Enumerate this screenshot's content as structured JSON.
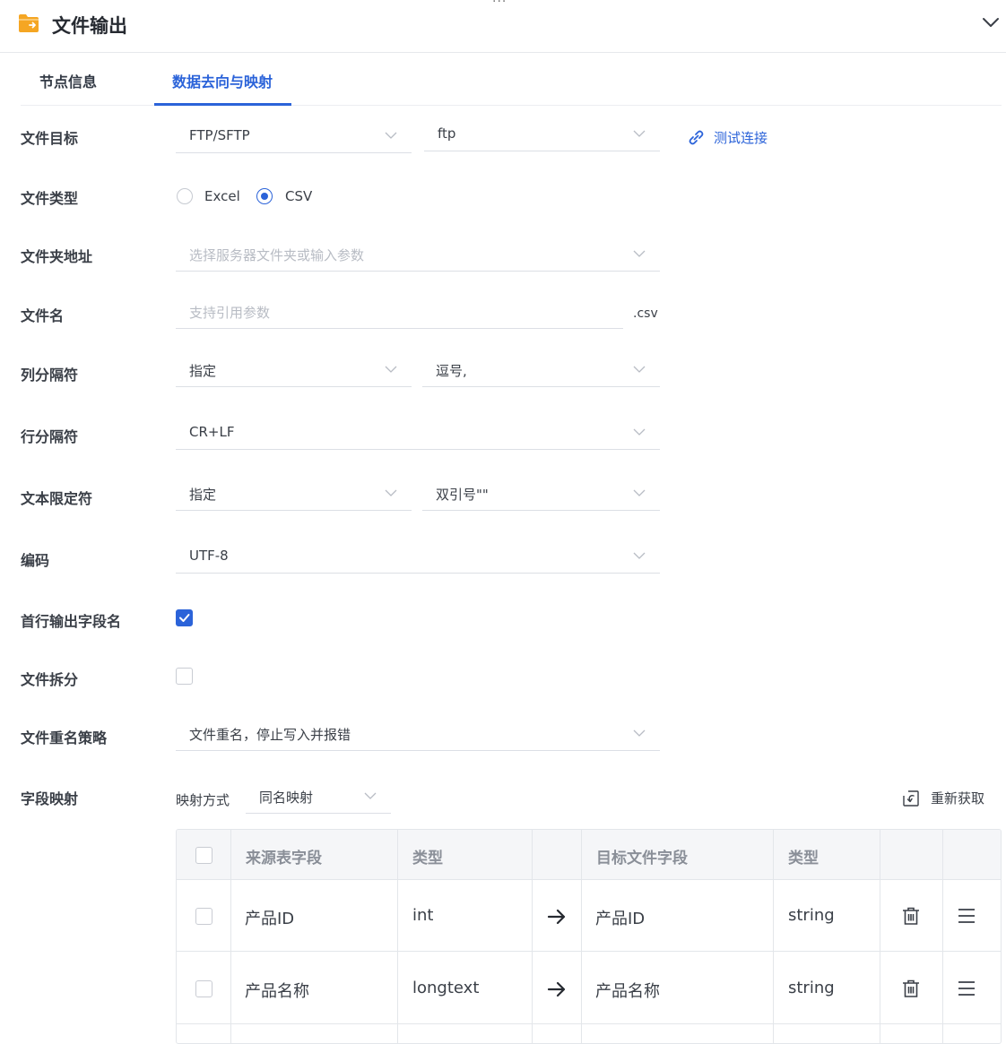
{
  "header": {
    "title": "文件输出",
    "top_fragment": "...",
    "icon": "folder-export-icon",
    "collapse_icon": "chevron-down-icon"
  },
  "tabs": [
    {
      "label": "节点信息",
      "active": false
    },
    {
      "label": "数据去向与映射",
      "active": true
    }
  ],
  "form": {
    "file_target": {
      "label": "文件目标",
      "type_value": "FTP/SFTP",
      "conn_value": "ftp",
      "test_label": "测试连接"
    },
    "file_type": {
      "label": "文件类型",
      "options": [
        "Excel",
        "CSV"
      ],
      "selected": "CSV"
    },
    "folder": {
      "label": "文件夹地址",
      "placeholder": "选择服务器文件夹或输入参数"
    },
    "file_name": {
      "label": "文件名",
      "placeholder": "支持引用参数",
      "suffix": ".csv"
    },
    "col_sep": {
      "label": "列分隔符",
      "mode": "指定",
      "value": "逗号,"
    },
    "row_sep": {
      "label": "行分隔符",
      "value": "CR+LF"
    },
    "text_qualifier": {
      "label": "文本限定符",
      "mode": "指定",
      "value": "双引号\"\""
    },
    "encoding": {
      "label": "编码",
      "value": "UTF-8"
    },
    "header_row": {
      "label": "首行输出字段名",
      "checked": true
    },
    "file_split": {
      "label": "文件拆分",
      "checked": false
    },
    "rename_policy": {
      "label": "文件重名策略",
      "value": "文件重名，停止写入并报错"
    },
    "field_mapping": {
      "label": "字段映射",
      "mode_label": "映射方式",
      "mode_value": "同名映射",
      "refresh_label": "重新获取"
    }
  },
  "table": {
    "headers": [
      "来源表字段",
      "类型",
      "目标文件字段",
      "类型"
    ],
    "rows": [
      {
        "source": "产品ID",
        "source_type": "int",
        "target": "产品ID",
        "target_type": "string"
      },
      {
        "source": "产品名称",
        "source_type": "longtext",
        "target": "产品名称",
        "target_type": "string"
      }
    ]
  },
  "colors": {
    "accent": "#2b63d9",
    "folder_icon": "#f5a623"
  }
}
